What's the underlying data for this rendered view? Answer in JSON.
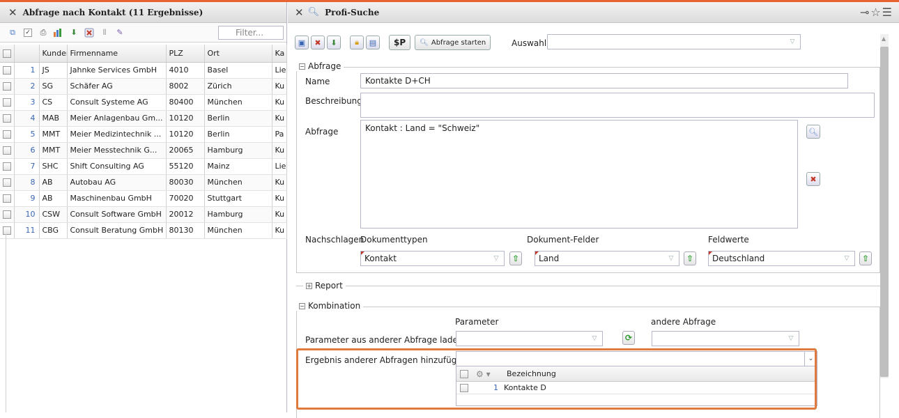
{
  "left": {
    "title": "Abfrage nach Kontakt (11 Ergebnisse)",
    "filter_placeholder": "Filter...",
    "columns": [
      "Kunden",
      "Firmenname",
      "PLZ",
      "Ort",
      "Ka"
    ],
    "rows": [
      {
        "n": "1",
        "kunden": "JS",
        "firma": "Jahnke Services GmbH",
        "plz": "4010",
        "ort": "Basel",
        "ka": "Lie"
      },
      {
        "n": "2",
        "kunden": "SG",
        "firma": "Schäfer AG",
        "plz": "8002",
        "ort": "Zürich",
        "ka": "Ku"
      },
      {
        "n": "3",
        "kunden": "CS",
        "firma": "Consult Systeme AG",
        "plz": "80400",
        "ort": "München",
        "ka": "Ku"
      },
      {
        "n": "4",
        "kunden": "MAB",
        "firma": "Meier Anlagenbau Gm...",
        "plz": "10120",
        "ort": "Berlin",
        "ka": "Ku"
      },
      {
        "n": "5",
        "kunden": "MMT",
        "firma": "Meier Medizintechnik ...",
        "plz": "10120",
        "ort": "Berlin",
        "ka": "Pa"
      },
      {
        "n": "6",
        "kunden": "MMT",
        "firma": "Meier Messtechnik G...",
        "plz": "20065",
        "ort": "Hamburg",
        "ka": "Ku"
      },
      {
        "n": "7",
        "kunden": "SHC",
        "firma": "Shift Consulting AG",
        "plz": "55120",
        "ort": "Mainz",
        "ka": "Lie"
      },
      {
        "n": "8",
        "kunden": "AB",
        "firma": "Autobau AG",
        "plz": "80030",
        "ort": "München",
        "ka": "Ku"
      },
      {
        "n": "9",
        "kunden": "AB",
        "firma": "Maschinenbau GmbH",
        "plz": "70020",
        "ort": "Stuttgart",
        "ka": "Ku"
      },
      {
        "n": "10",
        "kunden": "CSW",
        "firma": "Consult Software GmbH",
        "plz": "20012",
        "ort": "Hamburg",
        "ka": "Ku"
      },
      {
        "n": "11",
        "kunden": "CBG",
        "firma": "Consult Beratung GmbH",
        "plz": "80130",
        "ort": "München",
        "ka": "Ku"
      }
    ]
  },
  "right": {
    "title": "Profi-Suche",
    "toolbar": {
      "dollar_p": "$P",
      "start_label": "Abfrage starten",
      "auswahl_label": "Auswahl"
    },
    "abfrage": {
      "legend": "Abfrage",
      "name_label": "Name",
      "name_value": "Kontakte D+CH",
      "beschreibung_label": "Beschreibung",
      "abfrage_label": "Abfrage",
      "abfrage_value": "Kontakt : Land = \"Schweiz\"",
      "nachschlagen_label": "Nachschlagen",
      "dokumenttypen_label": "Dokumenttypen",
      "dokumentfelder_label": "Dokument-Felder",
      "feldwerte_label": "Feldwerte",
      "dokumenttyp_value": "Kontakt",
      "feld_value": "Land",
      "feldwert_value": "Deutschland"
    },
    "report": {
      "legend": "Report"
    },
    "kombination": {
      "legend": "Kombination",
      "parameter_header": "Parameter",
      "andere_header": "andere Abfrage",
      "laden_label": "Parameter aus anderer Abfrage laden",
      "hinzufuegen_label": "Ergebnis anderer Abfragen hinzufügen",
      "grid_header": "Bezeichnung",
      "grid_rows": [
        {
          "n": "1",
          "bezeichnung": "Kontakte D"
        }
      ]
    }
  }
}
